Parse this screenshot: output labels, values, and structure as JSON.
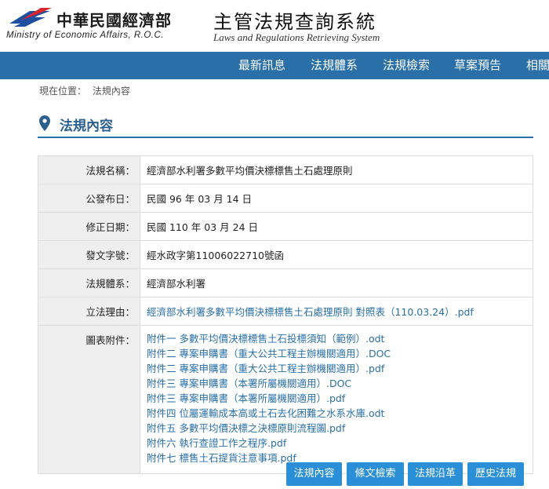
{
  "header": {
    "ministry_cn": "中華民國經濟部",
    "ministry_en": "Ministry of Economic Affairs, R.O.C.",
    "system_cn": "主管法規查詢系統",
    "system_en": "Laws and Regulations Retrieving System"
  },
  "nav": {
    "items": [
      {
        "label": "最新訊息"
      },
      {
        "label": "法規體系"
      },
      {
        "label": "法規檢索"
      },
      {
        "label": "草案預告"
      },
      {
        "label": "相關"
      }
    ]
  },
  "breadcrumb": {
    "prefix": "現在位置：",
    "current": "法規內容"
  },
  "section": {
    "title": "法規內容"
  },
  "info": {
    "rows": [
      {
        "label": "法規名稱：",
        "value": "經濟部水利署多數平均價決標標售土石處理原則"
      },
      {
        "label": "公發布日：",
        "value": "民國 96 年 03 月 14 日"
      },
      {
        "label": "修正日期：",
        "value": "民國 110 年 03 月 24 日"
      },
      {
        "label": "發文字號：",
        "value": "經水政字第11006022710號函"
      },
      {
        "label": "法規體系：",
        "value": "經濟部水利署"
      },
      {
        "label": "立法理由：",
        "value": "經濟部水利署多數平均價決標標售土石處理原則 對照表（110.03.24）.pdf"
      }
    ],
    "attachments_label": "圖表附件：",
    "attachments": [
      "附件一 多數平均價決標標售土石投標須知（範例）.odt",
      "附件二 專案申購書（重大公共工程主辦機關適用）.DOC",
      "附件二 專案申購書（重大公共工程主辦機關適用）.pdf",
      "附件三 專案申購書（本署所屬機關適用）.DOC",
      "附件三 專案申購書（本署所屬機關適用）.pdf",
      "附件四 位屬運輸成本高或土石去化困難之水系水庫.odt",
      "附件五 多數平均價決標之決標原則流程圖.pdf",
      "附件六 執行查證工作之程序.pdf",
      "附件七 標售土石提貨注意事項.pdf"
    ]
  },
  "buttons": {
    "content": "法規內容",
    "search": "條文檢索",
    "history": "法規沿革",
    "old": "歷史法規"
  },
  "colors": {
    "nav_bg": "#2a6fa8",
    "link": "#2a6fa8",
    "button_bg": "#2a8fd6",
    "logo_red": "#d9262e",
    "logo_blue": "#1f4fa0"
  }
}
